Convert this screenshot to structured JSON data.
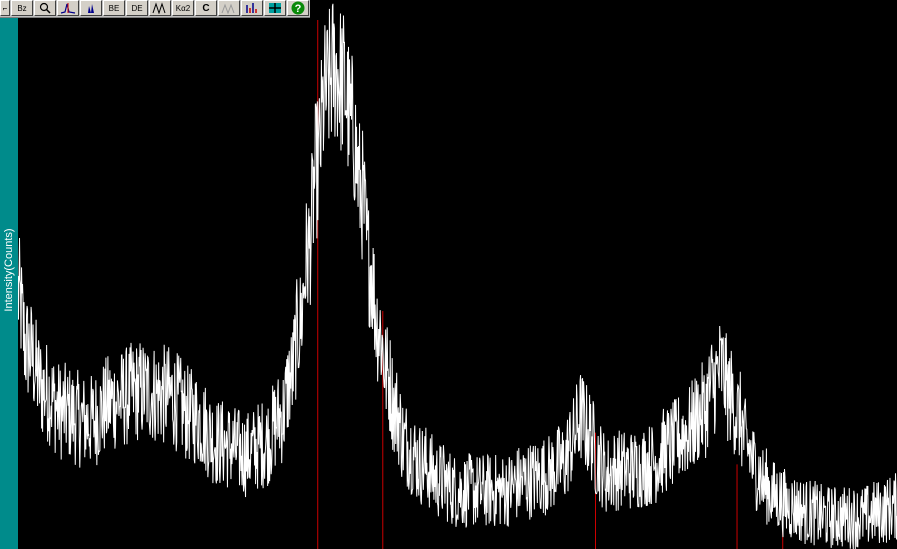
{
  "axis": {
    "ylabel": "Intensity(Counts)"
  },
  "toolbar": {
    "tools": [
      {
        "name": "corner",
        "label": "⌐"
      },
      {
        "name": "zoom-xy",
        "label": "Bz"
      },
      {
        "name": "magnify",
        "label": ""
      },
      {
        "name": "peak-fit",
        "label": ""
      },
      {
        "name": "peak-area",
        "label": ""
      },
      {
        "name": "background-edit",
        "label": "BE"
      },
      {
        "name": "data-edit",
        "label": "DE"
      },
      {
        "name": "peak-shape",
        "label": ""
      },
      {
        "name": "ka2-strip",
        "label": "Kα2"
      },
      {
        "name": "calibrate",
        "label": "C"
      },
      {
        "name": "smooth",
        "label": ""
      },
      {
        "name": "stick-pattern",
        "label": ""
      },
      {
        "name": "crosshair",
        "label": ""
      },
      {
        "name": "help",
        "label": "?"
      }
    ]
  },
  "colors": {
    "background": "#000000",
    "trace": "#ffffff",
    "reference_lines": "#cc0000",
    "axis_strip": "#008b8b"
  },
  "chart_data": {
    "type": "line",
    "xlim": [
      0,
      100
    ],
    "ylim": [
      0,
      100
    ],
    "series": [
      {
        "x": [
          0,
          1,
          3,
          5,
          8,
          11,
          14,
          17,
          20,
          23,
          26,
          28,
          30,
          31,
          32,
          33,
          34,
          35,
          36,
          37,
          38,
          39,
          40,
          41,
          42,
          43,
          44,
          46,
          48,
          50,
          52,
          55,
          58,
          60,
          62,
          63,
          64,
          65,
          66,
          67,
          68,
          70,
          72,
          74,
          76,
          78,
          79,
          80,
          81,
          82,
          83,
          84,
          85,
          86,
          88,
          90,
          92,
          94,
          96,
          98,
          100
        ],
        "y": [
          48,
          38,
          30,
          26,
          24,
          28,
          30,
          29,
          25,
          20,
          18,
          20,
          25,
          32,
          42,
          56,
          72,
          86,
          91,
          88,
          80,
          68,
          54,
          42,
          33,
          26,
          20,
          16,
          13,
          11,
          11,
          11,
          13,
          14,
          16,
          20,
          25,
          22,
          17,
          14,
          15,
          15,
          16,
          19,
          22,
          26,
          31,
          34,
          29,
          25,
          19,
          15,
          12,
          10,
          8,
          7,
          6,
          6,
          6,
          7,
          8
        ]
      }
    ],
    "reference_lines": [
      {
        "x": 34.1,
        "height": 100
      },
      {
        "x": 41.5,
        "height": 45
      },
      {
        "x": 65.7,
        "height": 22
      },
      {
        "x": 81.8,
        "height": 16
      },
      {
        "x": 87.0,
        "height": 6
      }
    ]
  }
}
